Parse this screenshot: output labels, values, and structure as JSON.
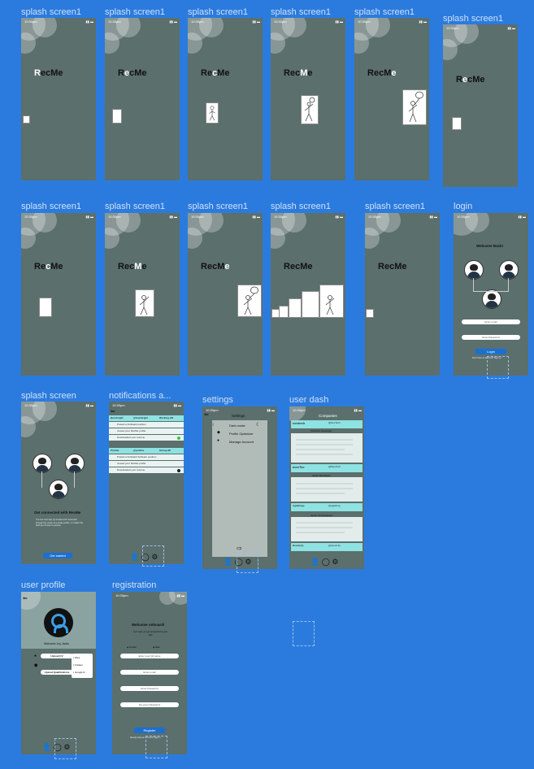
{
  "frames": [
    {
      "id": "f1",
      "title": "splash screen1"
    },
    {
      "id": "f2",
      "title": "splash screen1"
    },
    {
      "id": "f3",
      "title": "splash screen1"
    },
    {
      "id": "f4",
      "title": "splash screen1"
    },
    {
      "id": "f5",
      "title": "splash screen1"
    },
    {
      "id": "f6",
      "title": "splash screen1"
    },
    {
      "id": "f7",
      "title": "splash screen1"
    },
    {
      "id": "f8",
      "title": "splash screen1"
    },
    {
      "id": "f9",
      "title": "splash screen1"
    },
    {
      "id": "f10",
      "title": "splash screen1"
    },
    {
      "id": "f11",
      "title": "splash screen1"
    },
    {
      "id": "f12",
      "title": "login"
    },
    {
      "id": "f13",
      "title": "splash screen"
    },
    {
      "id": "f14",
      "title": "notifications a..."
    },
    {
      "id": "f15",
      "title": "settings"
    },
    {
      "id": "f16",
      "title": "user dash"
    },
    {
      "id": "f17",
      "title": "user profile"
    },
    {
      "id": "f18",
      "title": "registration"
    }
  ],
  "status_time": "10:30pm",
  "logo": {
    "a": "R",
    "b": "e",
    "c": "c",
    "d": "M",
    "e": "e"
  },
  "login": {
    "welcome": "Welcome Back!",
    "email_placeholder": "Enter email",
    "password_placeholder": "Enter Password",
    "login_button": "Login",
    "link": "Don't have an account? Sign up"
  },
  "onboard": {
    "title": "Get connected with RecMe",
    "desc": "You can now stay up-to-date and connected through the power of a single profile, no matter the field you choose to pursue.",
    "button": "Get started"
  },
  "notifications": {
    "groups": [
      {
        "head_left": "Buzzbright",
        "head_mid": "@buzzbright",
        "head_right": "Working HR",
        "items": [
          "Posted a Fullstack position",
          "viewed your RecMe profile",
          "Downloaded your resume"
        ]
      },
      {
        "head_left": "Prishta",
        "head_mid": "@prishta",
        "head_right": "Hiring HR",
        "items": [
          "Posted a Fullstack Software position",
          "viewed your RecMe profile",
          "Downloaded your resume"
        ]
      }
    ]
  },
  "settings": {
    "title": "Settings",
    "items": [
      "Dark mode",
      "Profile Optimizer",
      "Manage Account"
    ]
  },
  "dash": {
    "title": "Companies",
    "companies": [
      {
        "name": "nextech",
        "handle": "@NexTech",
        "role": "Fullstack Developer"
      },
      {
        "name": "meeTec",
        "handle": "@MeeTech",
        "role": "Junior Developer"
      },
      {
        "name": "Agilebrige",
        "handle": "@agilebrig",
        "role": "Junior C# Developer"
      },
      {
        "name": "Devolnity",
        "handle": "@devolnity",
        "role": ""
      }
    ]
  },
  "profile": {
    "welcome": "Welcome Joy Jacks",
    "field1": "Upload CV",
    "field2": "Upload Qualifications",
    "menu": [
      "Files",
      "Folders",
      "Google D"
    ]
  },
  "registration": {
    "title": "Welcome onboard!",
    "subtitle": "Let's help you get recognized in your field",
    "gender_a": "Female",
    "gender_b": "Male",
    "fields": [
      "Enter your full name",
      "Enter email",
      "Enter Password",
      "Re-enter Password"
    ],
    "button": "Register",
    "link": "Already have an account? Sign In"
  }
}
